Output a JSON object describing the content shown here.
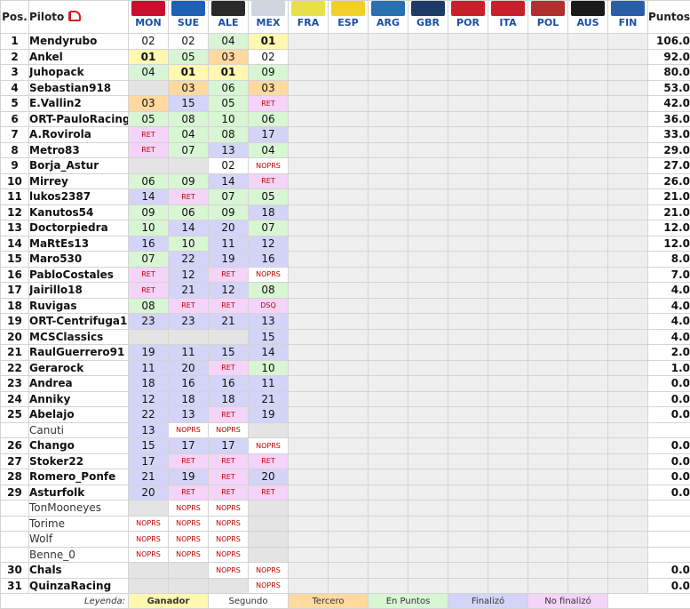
{
  "header": {
    "pos_label": "Pos.",
    "name_label": "Piloto",
    "points_label": "Puntos",
    "rallies": [
      {
        "code": "MON",
        "color": "#c8102e"
      },
      {
        "code": "SUE",
        "color": "#1f5fb5"
      },
      {
        "code": "ALE",
        "color": "#2a2a2a"
      },
      {
        "code": "MEX",
        "color": "#d0d6e0"
      },
      {
        "code": "FRA",
        "color": "#e8e04a"
      },
      {
        "code": "ESP",
        "color": "#f0d028"
      },
      {
        "code": "ARG",
        "color": "#2a6fb0"
      },
      {
        "code": "GBR",
        "color": "#1e3a66"
      },
      {
        "code": "POR",
        "color": "#c8202a"
      },
      {
        "code": "ITA",
        "color": "#c8202a"
      },
      {
        "code": "POL",
        "color": "#b03030"
      },
      {
        "code": "AUS",
        "color": "#1a1a1a"
      },
      {
        "code": "FIN",
        "color": "#2a5fa8"
      }
    ]
  },
  "status_colors": {
    "ganador": "#fff8b0",
    "segundo": "#ffffff",
    "tercero": "#ffd9a0",
    "puntos": "#d8f5d4",
    "finalizo": "#d4d4f8",
    "nofinalizo": "#f4d4f8",
    "noprs": "#ffffff",
    "none": "#e4e4e4"
  },
  "rows": [
    {
      "pos": "1",
      "name": "Mendyrubo",
      "points": "106.0",
      "results": [
        [
          "02",
          "seg"
        ],
        [
          "02",
          "seg"
        ],
        [
          "04",
          "pts"
        ],
        [
          "01",
          "win"
        ]
      ]
    },
    {
      "pos": "2",
      "name": "Ankel",
      "points": "92.0",
      "results": [
        [
          "01",
          "win"
        ],
        [
          "05",
          "pts"
        ],
        [
          "03",
          "ter"
        ],
        [
          "02",
          "seg"
        ]
      ]
    },
    {
      "pos": "3",
      "name": "Juhopack",
      "points": "80.0",
      "results": [
        [
          "04",
          "pts"
        ],
        [
          "01",
          "win"
        ],
        [
          "01",
          "win"
        ],
        [
          "09",
          "pts"
        ]
      ]
    },
    {
      "pos": "4",
      "name": "Sebastian918",
      "points": "53.0",
      "results": [
        [
          "",
          ""
        ],
        [
          "03",
          "ter"
        ],
        [
          "06",
          "pts"
        ],
        [
          "03",
          "ter"
        ]
      ]
    },
    {
      "pos": "5",
      "name": "E.Vallin2",
      "points": "42.0",
      "results": [
        [
          "03",
          "ter"
        ],
        [
          "15",
          "fin"
        ],
        [
          "05",
          "pts"
        ],
        [
          "RET",
          "ret"
        ]
      ]
    },
    {
      "pos": "6",
      "name": "ORT-PauloRacing",
      "points": "36.0",
      "results": [
        [
          "05",
          "pts"
        ],
        [
          "08",
          "pts"
        ],
        [
          "10",
          "pts"
        ],
        [
          "06",
          "pts"
        ]
      ]
    },
    {
      "pos": "7",
      "name": "A.Rovirola",
      "points": "33.0",
      "results": [
        [
          "RET",
          "ret"
        ],
        [
          "04",
          "pts"
        ],
        [
          "08",
          "pts"
        ],
        [
          "17",
          "fin"
        ]
      ]
    },
    {
      "pos": "8",
      "name": "Metro83",
      "points": "29.0",
      "results": [
        [
          "RET",
          "ret"
        ],
        [
          "07",
          "pts"
        ],
        [
          "13",
          "fin"
        ],
        [
          "04",
          "pts"
        ]
      ]
    },
    {
      "pos": "9",
      "name": "Borja_Astur",
      "points": "27.0",
      "results": [
        [
          "",
          ""
        ],
        [
          "",
          ""
        ],
        [
          "02",
          "seg"
        ],
        [
          "NOPRS",
          "noprs"
        ]
      ]
    },
    {
      "pos": "10",
      "name": "Mirrey",
      "points": "26.0",
      "results": [
        [
          "06",
          "pts"
        ],
        [
          "09",
          "pts"
        ],
        [
          "14",
          "fin"
        ],
        [
          "RET",
          "ret"
        ]
      ]
    },
    {
      "pos": "11",
      "name": "lukos2387",
      "points": "21.0",
      "results": [
        [
          "14",
          "fin"
        ],
        [
          "RET",
          "ret"
        ],
        [
          "07",
          "pts"
        ],
        [
          "05",
          "pts"
        ]
      ]
    },
    {
      "pos": "12",
      "name": "Kanutos54",
      "points": "21.0",
      "results": [
        [
          "09",
          "pts"
        ],
        [
          "06",
          "pts"
        ],
        [
          "09",
          "pts"
        ],
        [
          "18",
          "fin"
        ]
      ]
    },
    {
      "pos": "13",
      "name": "Doctorpiedra",
      "points": "12.0",
      "results": [
        [
          "10",
          "pts"
        ],
        [
          "14",
          "fin"
        ],
        [
          "20",
          "fin"
        ],
        [
          "07",
          "pts"
        ]
      ]
    },
    {
      "pos": "14",
      "name": "MaRtEs13",
      "points": "12.0",
      "results": [
        [
          "16",
          "fin"
        ],
        [
          "10",
          "pts"
        ],
        [
          "11",
          "fin"
        ],
        [
          "12",
          "fin"
        ]
      ]
    },
    {
      "pos": "15",
      "name": "Maro530",
      "points": "8.0",
      "results": [
        [
          "07",
          "pts"
        ],
        [
          "22",
          "fin"
        ],
        [
          "19",
          "fin"
        ],
        [
          "16",
          "fin"
        ]
      ]
    },
    {
      "pos": "16",
      "name": "PabloCostales",
      "points": "7.0",
      "results": [
        [
          "RET",
          "ret"
        ],
        [
          "12",
          "fin"
        ],
        [
          "RET",
          "ret"
        ],
        [
          "NOPRS",
          "noprs"
        ]
      ]
    },
    {
      "pos": "17",
      "name": "Jairillo18",
      "points": "4.0",
      "results": [
        [
          "RET",
          "ret"
        ],
        [
          "21",
          "fin"
        ],
        [
          "12",
          "fin"
        ],
        [
          "08",
          "pts"
        ]
      ]
    },
    {
      "pos": "18",
      "name": "Ruvigas",
      "points": "4.0",
      "results": [
        [
          "08",
          "pts"
        ],
        [
          "RET",
          "ret"
        ],
        [
          "RET",
          "ret"
        ],
        [
          "DSQ",
          "ret"
        ]
      ]
    },
    {
      "pos": "19",
      "name": "ORT-Centrifuga18",
      "points": "4.0",
      "results": [
        [
          "23",
          "fin"
        ],
        [
          "23",
          "fin"
        ],
        [
          "21",
          "fin"
        ],
        [
          "13",
          "fin"
        ]
      ]
    },
    {
      "pos": "20",
      "name": "MCSClassics",
      "points": "4.0",
      "results": [
        [
          "",
          ""
        ],
        [
          "",
          ""
        ],
        [
          "",
          ""
        ],
        [
          "15",
          "fin"
        ]
      ]
    },
    {
      "pos": "21",
      "name": "RaulGuerrero91",
      "points": "2.0",
      "results": [
        [
          "19",
          "fin"
        ],
        [
          "11",
          "fin"
        ],
        [
          "15",
          "fin"
        ],
        [
          "14",
          "fin"
        ]
      ]
    },
    {
      "pos": "22",
      "name": "Gerarock",
      "points": "1.0",
      "results": [
        [
          "11",
          "fin"
        ],
        [
          "20",
          "fin"
        ],
        [
          "RET",
          "ret"
        ],
        [
          "10",
          "pts"
        ]
      ]
    },
    {
      "pos": "23",
      "name": "Andrea",
      "points": "0.0",
      "results": [
        [
          "18",
          "fin"
        ],
        [
          "16",
          "fin"
        ],
        [
          "16",
          "fin"
        ],
        [
          "11",
          "fin"
        ]
      ]
    },
    {
      "pos": "24",
      "name": "Anniky",
      "points": "0.0",
      "results": [
        [
          "12",
          "fin"
        ],
        [
          "18",
          "fin"
        ],
        [
          "18",
          "fin"
        ],
        [
          "21",
          "fin"
        ]
      ]
    },
    {
      "pos": "25",
      "name": "Abelajo",
      "points": "0.0",
      "results": [
        [
          "22",
          "fin"
        ],
        [
          "13",
          "fin"
        ],
        [
          "RET",
          "ret"
        ],
        [
          "19",
          "fin"
        ]
      ]
    },
    {
      "pos": "",
      "name": "Canuti",
      "points": "",
      "results": [
        [
          "13",
          "fin"
        ],
        [
          "NOPRS",
          "noprs"
        ],
        [
          "NOPRS",
          "noprs"
        ],
        [
          "",
          ""
        ]
      ]
    },
    {
      "pos": "26",
      "name": "Chango",
      "points": "0.0",
      "results": [
        [
          "15",
          "fin"
        ],
        [
          "17",
          "fin"
        ],
        [
          "17",
          "fin"
        ],
        [
          "NOPRS",
          "noprs"
        ]
      ]
    },
    {
      "pos": "27",
      "name": "Stoker22",
      "points": "0.0",
      "results": [
        [
          "17",
          "fin"
        ],
        [
          "RET",
          "ret"
        ],
        [
          "RET",
          "ret"
        ],
        [
          "RET",
          "ret"
        ]
      ]
    },
    {
      "pos": "28",
      "name": "Romero_Ponfe",
      "points": "0.0",
      "results": [
        [
          "21",
          "fin"
        ],
        [
          "19",
          "fin"
        ],
        [
          "RET",
          "ret"
        ],
        [
          "20",
          "fin"
        ]
      ]
    },
    {
      "pos": "29",
      "name": "Asturfolk",
      "points": "0.0",
      "results": [
        [
          "20",
          "fin"
        ],
        [
          "RET",
          "ret"
        ],
        [
          "RET",
          "ret"
        ],
        [
          "RET",
          "ret"
        ]
      ]
    },
    {
      "pos": "",
      "name": "TonMooneyes",
      "points": "",
      "results": [
        [
          "",
          ""
        ],
        [
          "NOPRS",
          "noprs"
        ],
        [
          "NOPRS",
          "noprs"
        ],
        [
          "",
          ""
        ]
      ]
    },
    {
      "pos": "",
      "name": "Torime",
      "points": "",
      "results": [
        [
          "NOPRS",
          "noprs"
        ],
        [
          "NOPRS",
          "noprs"
        ],
        [
          "NOPRS",
          "noprs"
        ],
        [
          "",
          ""
        ]
      ]
    },
    {
      "pos": "",
      "name": "Wolf",
      "points": "",
      "results": [
        [
          "NOPRS",
          "noprs"
        ],
        [
          "NOPRS",
          "noprs"
        ],
        [
          "NOPRS",
          "noprs"
        ],
        [
          "",
          ""
        ]
      ]
    },
    {
      "pos": "",
      "name": "Benne_0",
      "points": "",
      "results": [
        [
          "NOPRS",
          "noprs"
        ],
        [
          "NOPRS",
          "noprs"
        ],
        [
          "NOPRS",
          "noprs"
        ],
        [
          "",
          ""
        ]
      ]
    },
    {
      "pos": "30",
      "name": "Chals",
      "points": "0.0",
      "results": [
        [
          "",
          ""
        ],
        [
          "",
          ""
        ],
        [
          "NOPRS",
          "noprs"
        ],
        [
          "NOPRS",
          "noprs"
        ]
      ]
    },
    {
      "pos": "31",
      "name": "QuinzaRacing",
      "points": "0.0",
      "results": [
        [
          "",
          ""
        ],
        [
          "",
          ""
        ],
        [
          "",
          ""
        ],
        [
          "NOPRS",
          "noprs"
        ]
      ]
    }
  ],
  "legend": {
    "title": "Leyenda:",
    "items": [
      {
        "label": "Ganador",
        "key": "ganador"
      },
      {
        "label": "Segundo",
        "key": "segundo"
      },
      {
        "label": "Tercero",
        "key": "tercero"
      },
      {
        "label": "En Puntos",
        "key": "puntos"
      },
      {
        "label": "Finalizó",
        "key": "finalizo"
      },
      {
        "label": "No finalizó",
        "key": "nofinalizo"
      }
    ]
  }
}
